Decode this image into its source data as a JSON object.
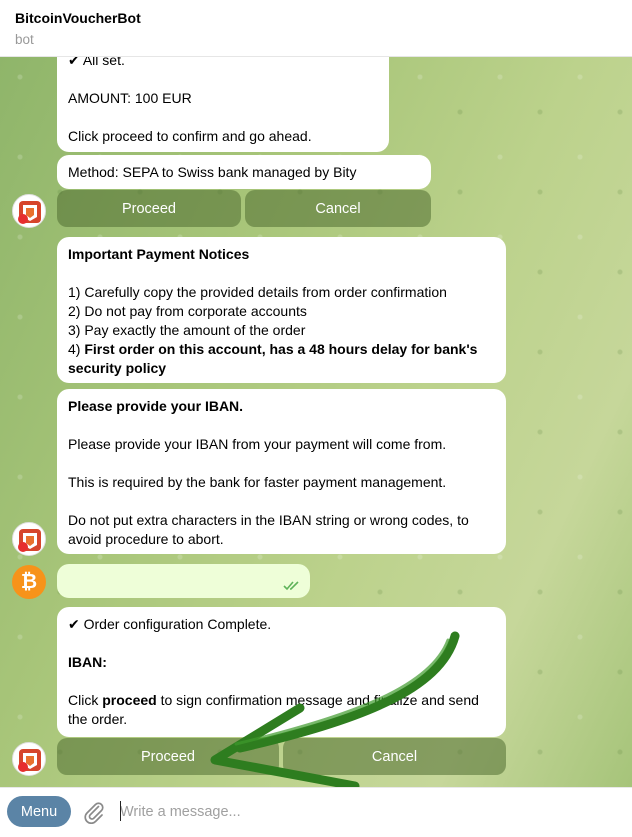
{
  "header": {
    "title": "BitcoinVoucherBot",
    "subtitle": "bot"
  },
  "messages": {
    "m1": {
      "line1": "✔ All set.",
      "line2": "AMOUNT: 100 EUR",
      "line3": "Click proceed to confirm and go ahead."
    },
    "m2": {
      "text": "Method: SEPA to Swiss bank managed by Bity"
    },
    "kb1": {
      "proceed": "Proceed",
      "cancel": "Cancel"
    },
    "m3": {
      "title": "Important Payment Notices",
      "l1": "1) Carefully copy the provided details from order confirmation",
      "l2": "2) Do not pay from corporate accounts",
      "l3": "3) Pay exactly the amount of the order",
      "l4_prefix": "4) ",
      "l4_bold": "First order on this account, has a 48 hours delay for bank's security policy"
    },
    "m4": {
      "title": "Please provide your IBAN.",
      "p1": "Please provide your IBAN from your payment will come from.",
      "p2": "This is required by the bank for faster payment management.",
      "p3": "Do not put extra characters in the IBAN string or wrong codes, to avoid procedure to abort."
    },
    "m5": {
      "check": "✔",
      "title": "Order configuration Complete.",
      "iban_label": "IBAN:",
      "p_prefix": "Click ",
      "p_bold": "proceed",
      "p_rest": " to sign confirmation message and finalize and send the order."
    },
    "kb2": {
      "proceed": "Proceed",
      "cancel": "Cancel"
    }
  },
  "composer": {
    "menu_label": "Menu",
    "placeholder": "Write a message..."
  },
  "colors": {
    "accent": "#5b84a6",
    "outgoing": "#eefed8",
    "annotation_arrow": "#2e7d1f",
    "bitcoin": "#f7931a"
  }
}
